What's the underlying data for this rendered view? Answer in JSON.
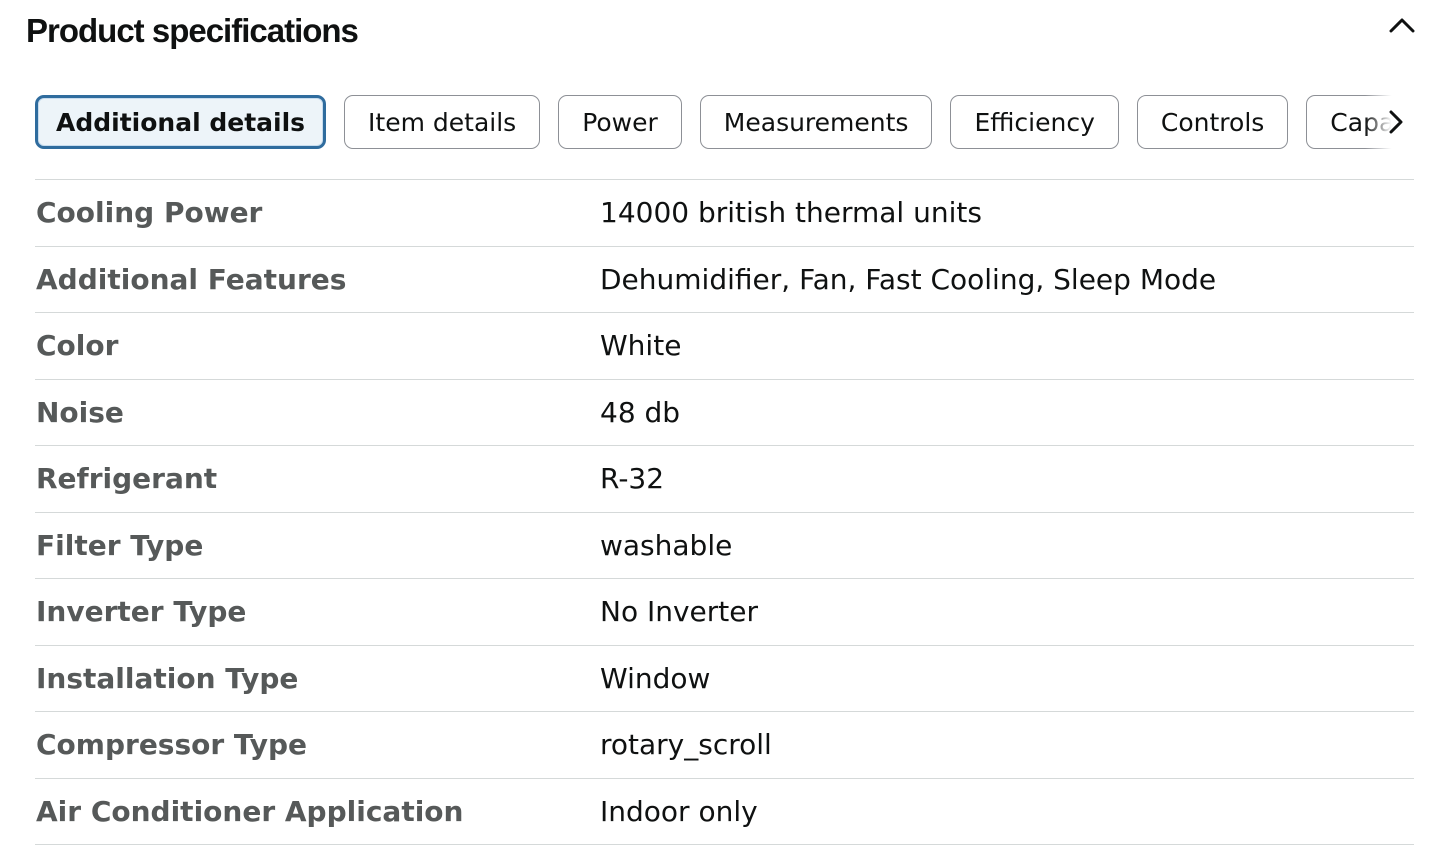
{
  "header": {
    "title": "Product specifications",
    "collapse_icon": "chevron-up-icon"
  },
  "tabs": [
    {
      "label": "Additional details",
      "active": true
    },
    {
      "label": "Item details",
      "active": false
    },
    {
      "label": "Power",
      "active": false
    },
    {
      "label": "Measurements",
      "active": false
    },
    {
      "label": "Efficiency",
      "active": false
    },
    {
      "label": "Controls",
      "active": false
    },
    {
      "label": "Capacity",
      "active": false
    }
  ],
  "tabs_next_icon": "chevron-right-icon",
  "specs": [
    {
      "label": "Cooling Power",
      "value": "14000 british thermal units"
    },
    {
      "label": "Additional Features",
      "value": "Dehumidifier, Fan, Fast Cooling, Sleep Mode"
    },
    {
      "label": "Color",
      "value": "White"
    },
    {
      "label": "Noise",
      "value": "48 db"
    },
    {
      "label": "Refrigerant",
      "value": "R-32"
    },
    {
      "label": "Filter Type",
      "value": "washable"
    },
    {
      "label": "Inverter Type",
      "value": "No Inverter"
    },
    {
      "label": "Installation Type",
      "value": "Window"
    },
    {
      "label": "Compressor Type",
      "value": "rotary_scroll"
    },
    {
      "label": "Air Conditioner Application",
      "value": "Indoor only"
    }
  ],
  "colors": {
    "active_tab_border": "#2f6c9e",
    "active_tab_bg": "#edf4f9",
    "label_text": "#565959",
    "value_text": "#0f1111"
  }
}
